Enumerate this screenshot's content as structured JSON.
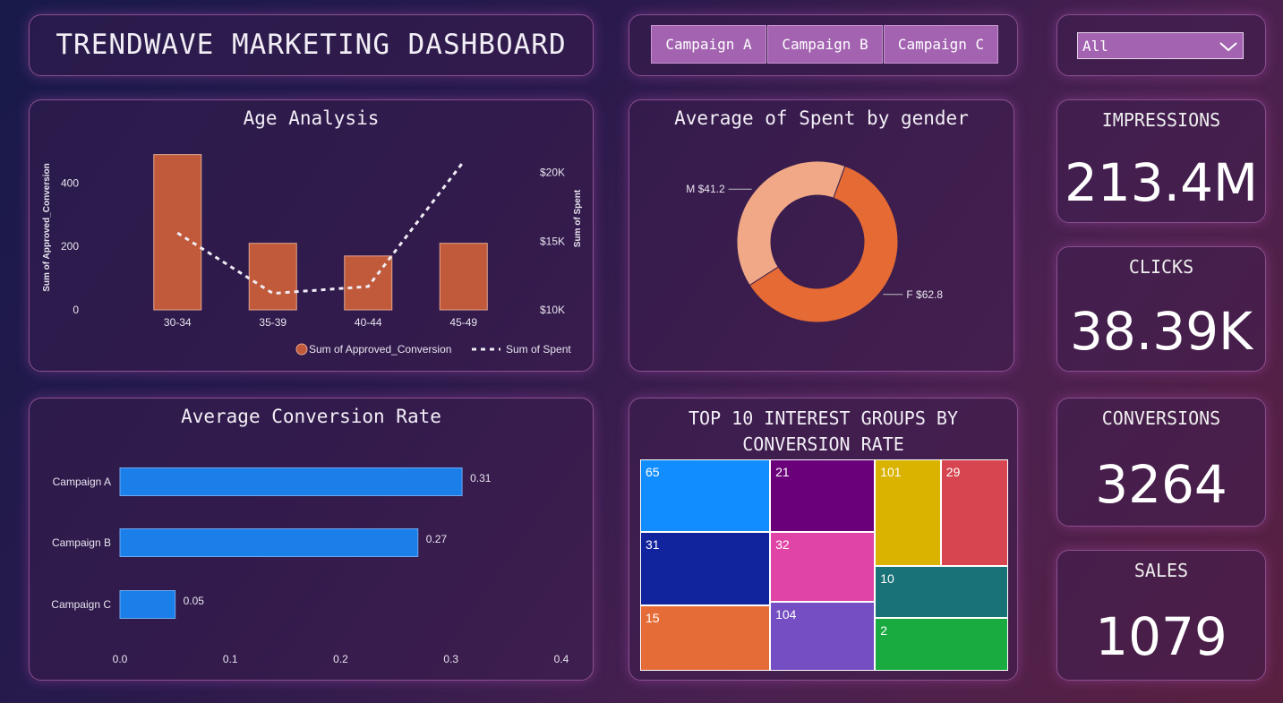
{
  "header": {
    "title": "TRENDWAVE MARKETING DASHBOARD"
  },
  "slicer": {
    "buttons": [
      {
        "label": "Campaign A"
      },
      {
        "label": "Campaign B"
      },
      {
        "label": "Campaign C"
      }
    ],
    "dropdown_value": "All",
    "accent": "#a363b1"
  },
  "kpis": {
    "impressions": {
      "label": "IMPRESSIONS",
      "value": "213.4M"
    },
    "clicks": {
      "label": "CLICKS",
      "value": "38.39K"
    },
    "conversions": {
      "label": "CONVERSIONS",
      "value": "3264"
    },
    "sales": {
      "label": "SALES",
      "value": "1079"
    }
  },
  "chart_data": [
    {
      "id": "age",
      "type": "bar",
      "title": "Age Analysis",
      "categories": [
        "30-34",
        "35-39",
        "40-44",
        "45-49"
      ],
      "y_label": "Sum of Approved_Conversion",
      "y_ticks": [
        "0",
        "200",
        "400"
      ],
      "y2_label": "Sum of Spent",
      "y2_ticks": [
        "$10K",
        "$15K",
        "$20K"
      ],
      "series": [
        {
          "name": "Sum of Approved_Conversion",
          "type": "bar",
          "values": [
            490,
            210,
            170,
            210
          ],
          "color": "#c15a3a"
        },
        {
          "name": "Sum of Spent",
          "type": "line",
          "values": [
            15600,
            11200,
            11700,
            20800
          ],
          "color": "#f0ecf4"
        }
      ],
      "ylim": [
        0,
        520
      ],
      "y2lim": [
        10000,
        22000
      ],
      "legend": "bottom-right"
    },
    {
      "id": "gender",
      "type": "pie",
      "title": "Average of Spent by gender",
      "slices": [
        {
          "label": "M $41.2",
          "value": 41.2,
          "color": "#f0a886"
        },
        {
          "label": "F $62.8",
          "value": 62.8,
          "color": "#e56a34"
        }
      ]
    },
    {
      "id": "conv_rate",
      "type": "bar",
      "title": "Average Conversion Rate",
      "categories": [
        "Campaign A",
        "Campaign B",
        "Campaign C"
      ],
      "values": [
        0.31,
        0.27,
        0.05
      ],
      "value_labels": [
        "0.31",
        "0.27",
        "0.05"
      ],
      "x_ticks": [
        "0.0",
        "0.1",
        "0.2",
        "0.3",
        "0.4"
      ],
      "xlim": [
        0,
        0.4
      ],
      "color": "#1a7fe8"
    },
    {
      "id": "interest",
      "type": "treemap",
      "title": "TOP 10 INTEREST GROUPS BY CONVERSION RATE",
      "items": [
        {
          "label": "65",
          "color": "#118dff"
        },
        {
          "label": "31",
          "color": "#12239e"
        },
        {
          "label": "15",
          "color": "#e66c37"
        },
        {
          "label": "21",
          "color": "#6b007b"
        },
        {
          "label": "32",
          "color": "#e044a7"
        },
        {
          "label": "104",
          "color": "#744ec2"
        },
        {
          "label": "101",
          "color": "#d9b300"
        },
        {
          "label": "29",
          "color": "#d64550"
        },
        {
          "label": "10",
          "color": "#197278"
        },
        {
          "label": "2",
          "color": "#1aab40"
        }
      ]
    }
  ]
}
